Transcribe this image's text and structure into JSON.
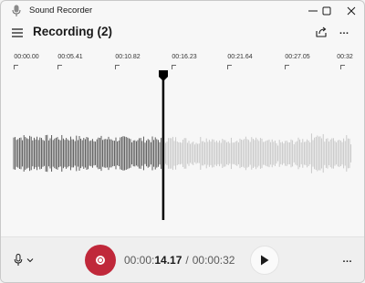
{
  "window": {
    "app_title": "Sound Recorder",
    "controls": {
      "minimize_icon": "minimize-icon",
      "maximize_icon": "maximize-icon",
      "close_icon": "close-icon"
    }
  },
  "header": {
    "menu_icon": "hamburger-icon",
    "title": "Recording (2)",
    "share_icon": "share-icon",
    "more_label": "…"
  },
  "timeline": {
    "ticks": [
      "00:00.00",
      "00:05.41",
      "00:10.82",
      "00:16.23",
      "00:21.64",
      "00:27.05",
      "00:32"
    ]
  },
  "playback": {
    "progress_fraction": 0.443,
    "elapsed_prefix": "00:00:",
    "elapsed_main": "14.17",
    "separator": "/",
    "total": "00:00:32"
  },
  "bottom": {
    "mic_icon": "microphone-icon",
    "dropdown_icon": "chevron-down-icon",
    "record_icon": "record-icon",
    "play_icon": "play-icon",
    "more_label": "…"
  },
  "colors": {
    "record_red": "#c0283a",
    "waveform_played": "#4a4a4a",
    "waveform_unplayed": "#c4c4c4",
    "playhead": "#000000"
  }
}
